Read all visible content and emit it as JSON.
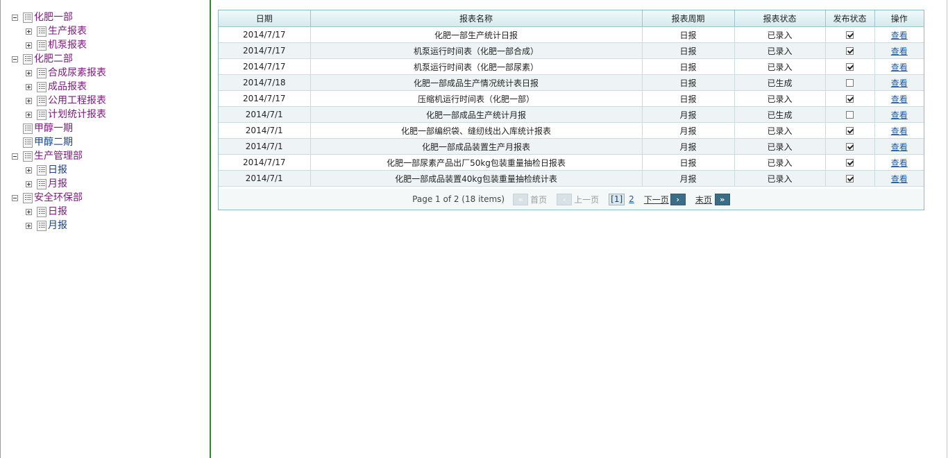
{
  "tree": {
    "dept1": {
      "label": "化肥一部",
      "children": [
        "生产报表",
        "机泵报表"
      ]
    },
    "dept2": {
      "label": "化肥二部",
      "children": [
        "合成尿素报表",
        "成品报表",
        "公用工程报表",
        "计划统计报表"
      ]
    },
    "methanol1": {
      "label": "甲醇一期"
    },
    "methanol2": {
      "label": "甲醇二期"
    },
    "prod_mgmt": {
      "label": "生产管理部",
      "children": [
        "日报",
        "月报"
      ]
    },
    "safety": {
      "label": "安全环保部",
      "children": [
        "日报",
        "月报"
      ]
    }
  },
  "grid": {
    "columns": [
      "日期",
      "报表名称",
      "报表周期",
      "报表状态",
      "发布状态",
      "操作"
    ],
    "rows": [
      {
        "date": "2014/7/17",
        "name": "化肥一部生产统计日报",
        "period": "日报",
        "status": "已录入",
        "published": true,
        "action": "查看"
      },
      {
        "date": "2014/7/17",
        "name": "机泵运行时间表（化肥一部合成）",
        "period": "日报",
        "status": "已录入",
        "published": true,
        "action": "查看"
      },
      {
        "date": "2014/7/17",
        "name": "机泵运行时间表（化肥一部尿素）",
        "period": "日报",
        "status": "已录入",
        "published": true,
        "action": "查看"
      },
      {
        "date": "2014/7/18",
        "name": "化肥一部成品生产情况统计表日报",
        "period": "日报",
        "status": "已生成",
        "published": false,
        "action": "查看"
      },
      {
        "date": "2014/7/17",
        "name": "压缩机运行时间表（化肥一部）",
        "period": "日报",
        "status": "已录入",
        "published": true,
        "action": "查看"
      },
      {
        "date": "2014/7/1",
        "name": "化肥一部成品生产统计月报",
        "period": "月报",
        "status": "已生成",
        "published": false,
        "action": "查看"
      },
      {
        "date": "2014/7/1",
        "name": "化肥一部编织袋、缝纫线出入库统计报表",
        "period": "月报",
        "status": "已录入",
        "published": true,
        "action": "查看"
      },
      {
        "date": "2014/7/1",
        "name": "化肥一部成品装置生产月报表",
        "period": "月报",
        "status": "已录入",
        "published": true,
        "action": "查看"
      },
      {
        "date": "2014/7/17",
        "name": "化肥一部尿素产品出厂50kg包装重量抽检日报表",
        "period": "日报",
        "status": "已录入",
        "published": true,
        "action": "查看"
      },
      {
        "date": "2014/7/1",
        "name": "化肥一部成品装置40kg包装重量抽检统计表",
        "period": "月报",
        "status": "已录入",
        "published": true,
        "action": "查看"
      }
    ]
  },
  "pager": {
    "info": "Page 1 of 2 (18 items)",
    "first": "首页",
    "prev": "上一页",
    "current": "[1]",
    "page2": "2",
    "next": "下一页",
    "last": "末页",
    "first_icon": "«",
    "prev_icon": "‹",
    "next_icon": "›",
    "last_icon": "»"
  },
  "colors": {
    "tree_link": "#7a1a7a",
    "tree_link_visited": "#1a3f8a",
    "divider": "#2a8a2a",
    "header_bg": "#d3ebee"
  }
}
